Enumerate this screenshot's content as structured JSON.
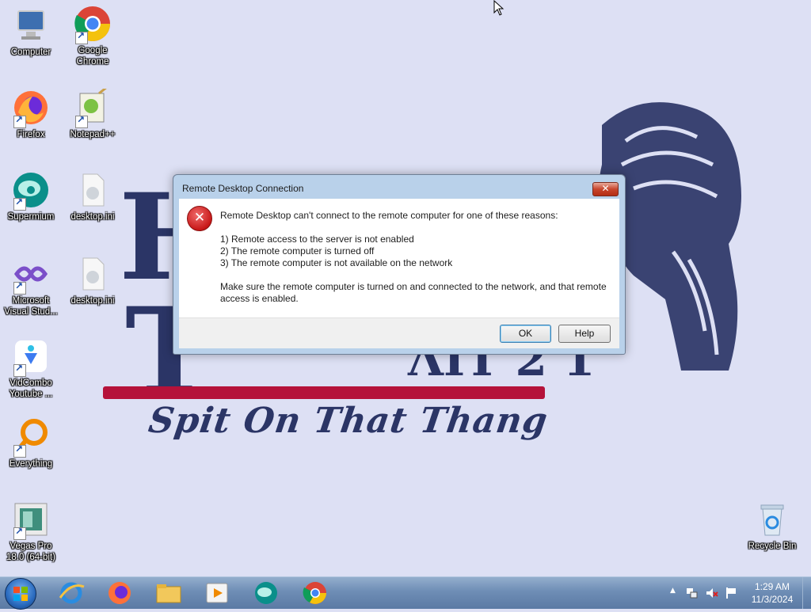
{
  "desktop": {
    "icons": [
      {
        "label": "Computer",
        "icon": "computer-icon"
      },
      {
        "label": "Google Chrome",
        "icon": "chrome-icon"
      },
      {
        "label": "Firefox",
        "icon": "firefox-icon"
      },
      {
        "label": "Notepad++",
        "icon": "notepadpp-icon"
      },
      {
        "label": "Supermium",
        "icon": "supermium-icon"
      },
      {
        "label": "desktop.ini",
        "icon": "ini-file-icon"
      },
      {
        "label": "Microsoft Visual Stud...",
        "icon": "visual-studio-icon"
      },
      {
        "label": "desktop.ini",
        "icon": "ini-file-icon"
      },
      {
        "label": "VidCombo Youtube ...",
        "icon": "vidcombo-icon"
      },
      {
        "label": "Everything",
        "icon": "everything-icon"
      },
      {
        "label": "Vegas Pro 18.0 (64-bit)",
        "icon": "vegas-pro-icon"
      },
      {
        "label": "Recycle Bin",
        "icon": "recycle-bin-icon"
      }
    ]
  },
  "wallpaper": {
    "slogan": "Spit On That Thang"
  },
  "dialog": {
    "title": "Remote Desktop Connection",
    "close_label": "✕",
    "message": "Remote Desktop can't connect to the remote computer for one of these reasons:",
    "reasons": [
      "1) Remote access to the server is not enabled",
      "2) The remote computer is turned off",
      "3) The remote computer is not available on the network"
    ],
    "advice": "Make sure the remote computer is turned on and connected to the network, and that remote access is enabled.",
    "ok_label": "OK",
    "help_label": "Help"
  },
  "taskbar": {
    "pinned": [
      "internet-explorer-icon",
      "firefox-icon",
      "file-explorer-icon",
      "media-player-icon",
      "supermium-icon",
      "chrome-icon"
    ],
    "clock": {
      "time": "1:29 AM",
      "date": "11/3/2024"
    },
    "tray_chevron": "▲",
    "tray_icons": [
      "network-icon",
      "volume-muted-icon",
      "action-center-flag-icon"
    ]
  }
}
